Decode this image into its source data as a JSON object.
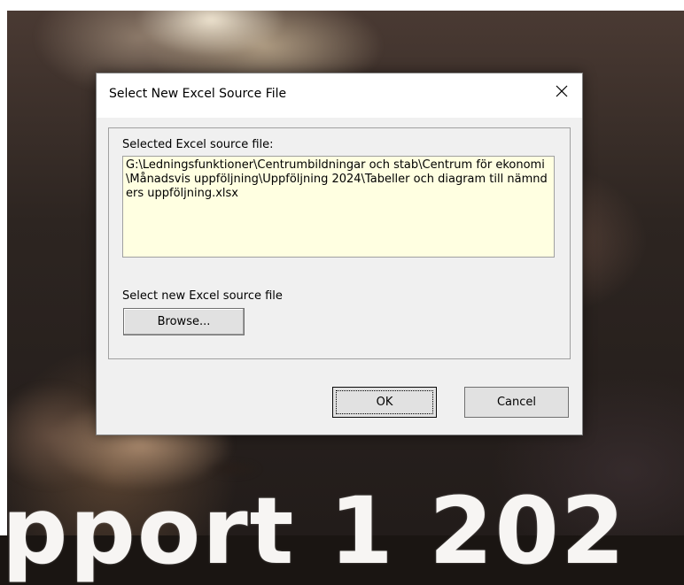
{
  "background": {
    "slide_title_fragment": "pport 1 202"
  },
  "dialog": {
    "title": "Select New Excel Source File",
    "close_glyph": "close-icon",
    "selected_label": "Selected Excel source file:",
    "selected_path": "G:\\Ledningsfunktioner\\Centrumbildningar och stab\\Centrum för ekonomi\\Månadsvis uppföljning\\Uppföljning 2024\\Tabeller och diagram till nämnders uppföljning.xlsx",
    "new_file_label": "Select new Excel source file",
    "browse_label": "Browse...",
    "ok_label": "OK",
    "cancel_label": "Cancel"
  },
  "colors": {
    "dialog_bg": "#f0f0f0",
    "path_bg": "#ffffe1",
    "button_bg": "#e1e1e1"
  }
}
